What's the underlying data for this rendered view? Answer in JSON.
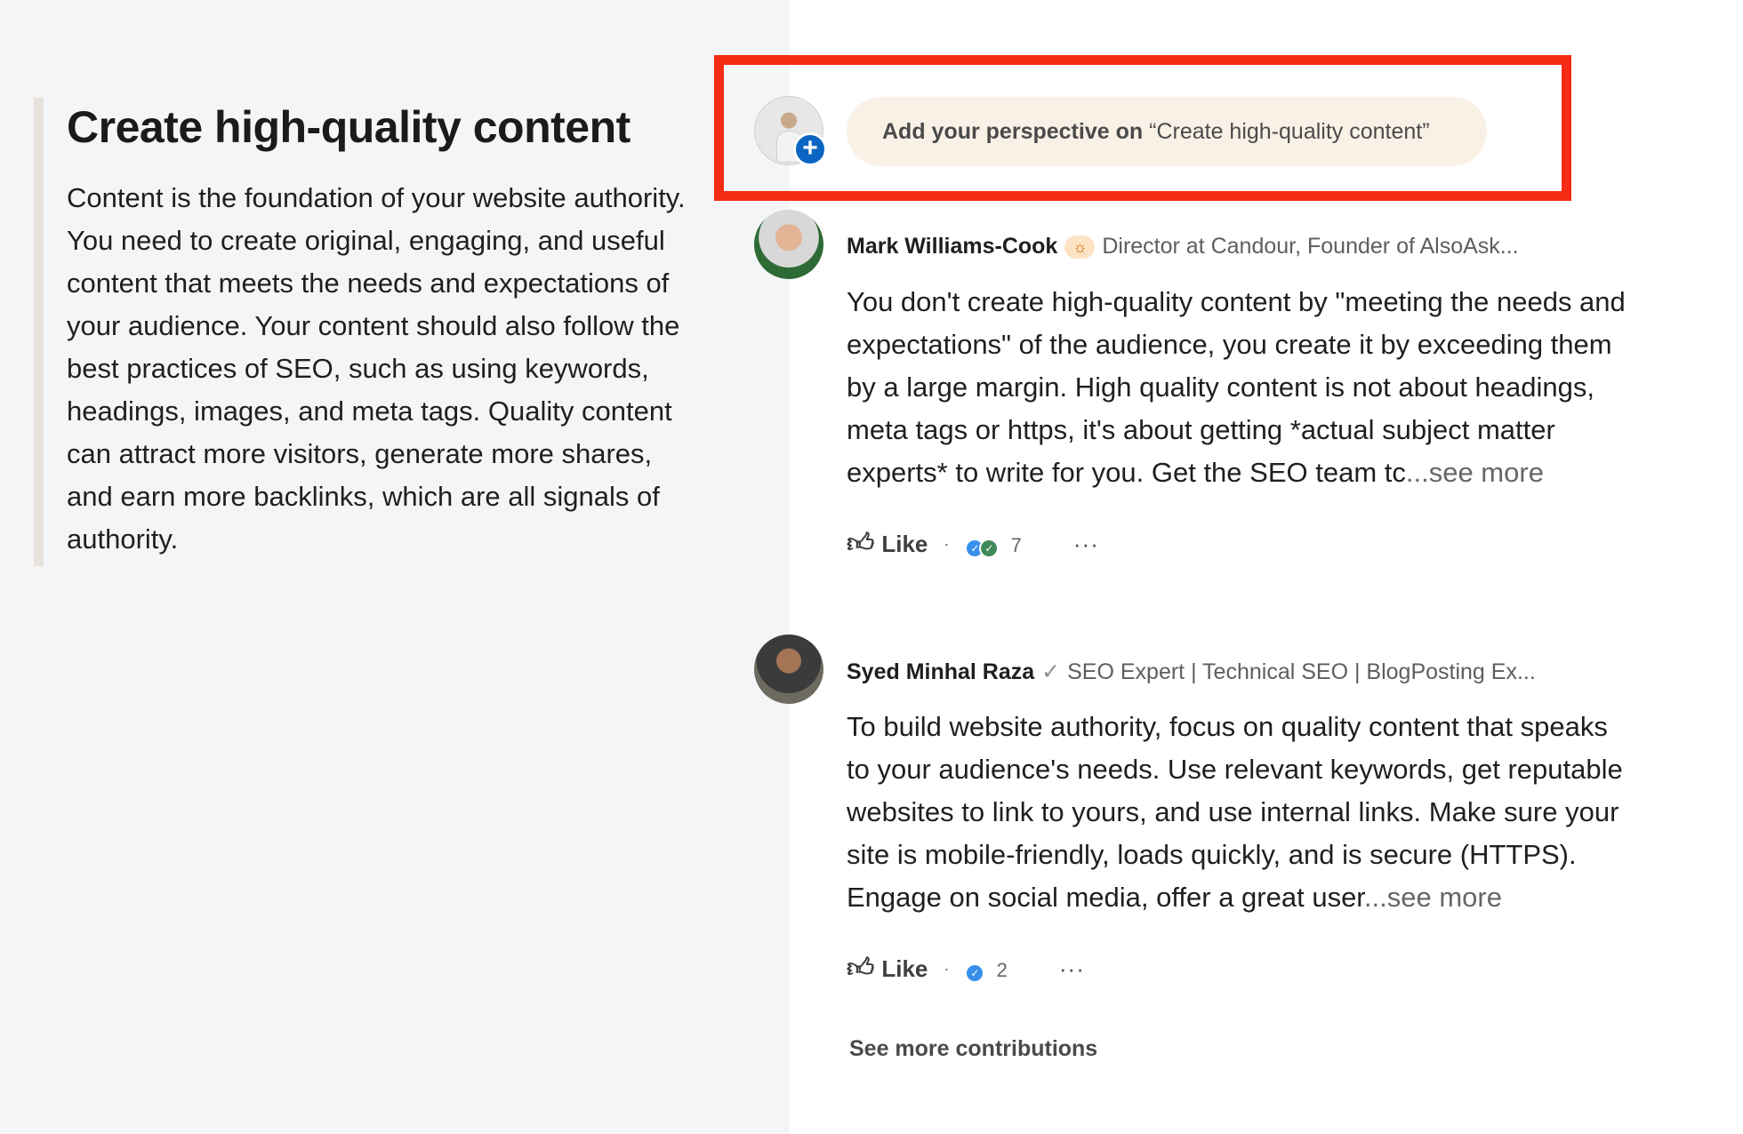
{
  "article": {
    "title": "Create high-quality content",
    "body": "Content is the foundation of your website authority. You need to create original, engaging, and useful content that meets the needs and expectations of your audience. Your content should also follow the best practices of SEO, such as using keywords, headings, images, and meta tags. Quality content can attract more visitors, generate more shares, and earn more backlinks, which are all signals of authority."
  },
  "perspective": {
    "bold": "Add your perspective on",
    "quoted": "“Create high-quality content”"
  },
  "contributions": [
    {
      "name": "Mark Williams-Cook",
      "badge_icon": "bulb-icon",
      "headline": "Director at Candour, Founder of AlsoAsk...",
      "text": "You don't create high-quality content by \"meeting the needs and expectations\" of the audience, you create it by exceeding them by a large margin. High quality content is not about headings, meta tags or https, it's about getting *actual subject matter experts* to write for you. Get the SEO team tc",
      "see_more": "...see more",
      "like_label": "Like",
      "reactions_count": "7"
    },
    {
      "name": "Syed Minhal Raza",
      "badge_icon": "verified-icon",
      "headline": "SEO Expert | Technical SEO | BlogPosting Ex...",
      "text": "To build website authority, focus on quality content that speaks to your audience's needs. Use relevant keywords, get reputable websites to link to yours, and use internal links. Make sure your site is mobile-friendly, loads quickly, and is secure (HTTPS). Engage on social media, offer a great user",
      "see_more": "...see more",
      "like_label": "Like",
      "reactions_count": "2"
    }
  ],
  "see_more_contributions": "See more contributions",
  "colors": {
    "highlight": "#f52b14",
    "accent": "#0a66c2",
    "pill": "#faf1e6"
  }
}
